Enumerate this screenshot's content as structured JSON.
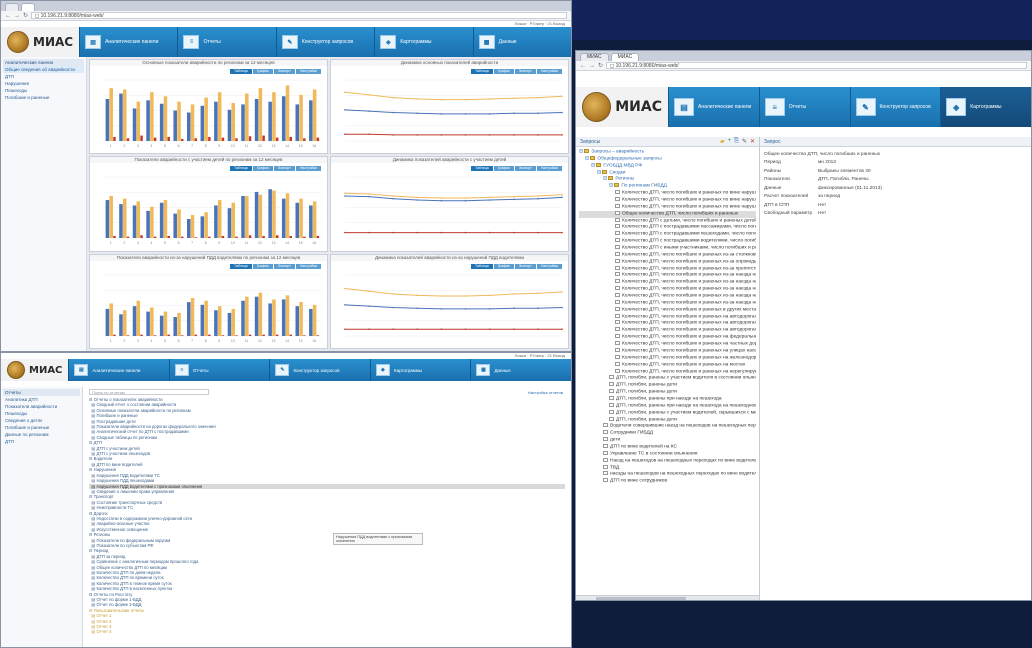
{
  "colors": {
    "accent_blue": "#1f74b6",
    "tile_blue": "#1a6fae",
    "bar_blue": "#4a73b8",
    "bar_orange": "#f0b95a",
    "bar_red": "#c0392b",
    "line_grey": "#bbbbbb"
  },
  "brand": "МИАС",
  "winA": {
    "tabs": [
      "",
      "",
      "x"
    ],
    "address": "◻ 10.196.21.9:8080/mias-web/",
    "topline": "Ложки · Р.Гомер · 21 Выход",
    "nav": [
      {
        "icon": "chart-icon",
        "label": "Аналитические панели"
      },
      {
        "icon": "report-icon",
        "label": "Отчеты"
      },
      {
        "icon": "constructor-icon",
        "label": "Конструктор запросов"
      },
      {
        "icon": "cartogram-icon",
        "label": "Картограммы"
      },
      {
        "icon": "data-icon",
        "label": "Данные"
      }
    ],
    "sidebar": {
      "head": "Аналитические панели",
      "items": [
        "Общие сведения об аварийности",
        "ДТП",
        "Нарушения",
        "Пешеходы",
        "Погибшие и раненые"
      ]
    },
    "panel_buttons": [
      "Таблица",
      "График",
      "Экспорт",
      "Настройки"
    ],
    "panels": [
      {
        "title": "Основные показатели аварийности по регионам за 12 месяцев"
      },
      {
        "title": "Динамика основных показателей аварийности"
      },
      {
        "title": "Показатели аварийности с участием детей по регионам за 12 месяцев"
      },
      {
        "title": "Динамика показателей аварийности с участием детей"
      },
      {
        "title": "Показатели аварийности из-за нарушений ПДД водителями по регионам за 12 месяцев"
      },
      {
        "title": "Динамика показателей аварийности из-за нарушений ПДД водителями"
      }
    ]
  },
  "winB": {
    "topline": "Ложки · Р.Гомер · 21 Выход",
    "nav": [
      {
        "icon": "chart-icon",
        "label": "Аналитические панели"
      },
      {
        "icon": "report-icon",
        "label": "Отчеты"
      },
      {
        "icon": "constructor-icon",
        "label": "Конструктор запросов"
      },
      {
        "icon": "cartogram-icon",
        "label": "Картограммы"
      },
      {
        "icon": "data-icon",
        "label": "Данные"
      }
    ],
    "sidebar": {
      "head": "Отчеты",
      "items": [
        "Аналитика ДТП",
        "Показатели аварийности",
        "Пешеходы",
        "Сведения о детях",
        "Погибшие и раненые",
        "Данные по регионам",
        "ДТП"
      ]
    },
    "search_placeholder": "Поиск по отчетам",
    "right_link": "Настройка отчетов",
    "tree": [
      "⊟ Отчеты о показателях аварийности",
      "  ▤ Сводный отчет о состоянии аварийности",
      "  ▤ Основные показатели аварийности по регионам",
      "  ▤ Погибшие и раненые",
      "  ▤ Пострадавшие дети",
      "  ▤ Показатели аварийности на дорогах федерального значения",
      "  ▤ Аналитический отчет по ДТП с пострадавшими",
      "  ▤ Сводные таблицы по регионам",
      "⊟ ДТП",
      "  ▤ ДТП с участием детей",
      "  ▤ ДТП с участием пешеходов",
      "⊟ Водители",
      "  ▤ ДТП по вине водителей",
      "⊟ Нарушения",
      "  ▤ Нарушения ПДД водителями ТС",
      "  ▤ Нарушения ПДД пешеходами",
      "  ▤ Нарушения ПДД водителями с признаками опьянения",
      "  ▤ Сведения о лишении права управления",
      "⊟ Транспорт",
      "  ▤ Состояние транспортных средств",
      "  ▤ Неисправности ТС",
      "⊟ Дороги",
      "  ▤ Недостатки в содержании улично-дорожной сети",
      "  ▤ Аварийно-опасные участки",
      "  ▤ Искусственное освещение",
      "⊟ Регионы",
      "  ▤ Показатели по федеральным округам",
      "  ▤ Показатели по субъектам РФ",
      "⊟ Период",
      "  ▤ ДТП за период",
      "  ▤ Сравнение с аналогичным периодом прошлого года",
      "  ▤ Общее количество ДТП по месяцам",
      "  ▤ Количество ДТП по дням недели",
      "  ▤ Количество ДТП по времени суток",
      "  ▤ Количество ДТП в темное время суток",
      "  ▤ Количество ДТП в населенных пунктах",
      "⊟ Отчеты по Росстату",
      "  ▤ Отчет по форме 1-БДД",
      "  ▤ Отчет по форме 2-БДД",
      "⊟ Пользовательские отчеты",
      "  ▤ Отчет 1",
      "  ▤ Отчет 2",
      "  ▤ Отчет 3",
      "  ▤ Отчет 4"
    ],
    "selected_index": 16,
    "tooltip": "Нарушения ПДД водителями с признаками опьянения"
  },
  "winC": {
    "tabs": [
      "МИАС",
      "МИАС",
      "x"
    ],
    "address": "◻ 10.196.21.9:8080/mias-web/",
    "nav": [
      {
        "icon": "chart-icon",
        "label": "Аналитические панели"
      },
      {
        "icon": "report-icon",
        "label": "Отчеты"
      },
      {
        "icon": "constructor-icon",
        "label": "Конструктор запросов"
      },
      {
        "icon": "cartogram-icon",
        "label": "Картограммы"
      }
    ],
    "left_head": "Запросы",
    "right_head": "Запрос",
    "tree": [
      {
        "t": "⊟",
        "i": "folder",
        "d": 0,
        "label": "Запросы – аварийность",
        "cls": "lnk"
      },
      {
        "t": "⊟",
        "i": "folder",
        "d": 1,
        "label": "Общефедеральные запросы",
        "cls": "lnk"
      },
      {
        "t": "⊟",
        "i": "folder",
        "d": 2,
        "label": "ГУОБДД МВД РФ",
        "cls": "lnk"
      },
      {
        "t": "⊟",
        "i": "folder",
        "d": 3,
        "label": "Сводки",
        "cls": "lnk"
      },
      {
        "t": "⊟",
        "i": "folder",
        "d": 4,
        "label": "Регионы",
        "cls": "lnk"
      },
      {
        "t": "⊟",
        "i": "folder",
        "d": 5,
        "label": "По регионам ГИБДД",
        "cls": "lnk"
      },
      {
        "t": "",
        "i": "doc",
        "d": 6,
        "label": "Количество ДТП, число погибших и раненых по вине нарушителей"
      },
      {
        "t": "",
        "i": "doc",
        "d": 6,
        "label": "Количество ДТП, число погибших и раненых по вине нарушителей"
      },
      {
        "t": "",
        "i": "doc",
        "d": 6,
        "label": "Количество ДТП, число погибших и раненых по вине нарушителей"
      },
      {
        "t": "",
        "i": "doc",
        "d": 6,
        "label": "Общее количество ДТП, число погибших и раненых",
        "cls": "sel"
      },
      {
        "t": "",
        "i": "doc",
        "d": 6,
        "label": "Количество ДТП с детьми, число погибших и раненых детей"
      },
      {
        "t": "",
        "i": "doc",
        "d": 6,
        "label": "Количество ДТП с пострадавшими пассажирами, число погибших"
      },
      {
        "t": "",
        "i": "doc",
        "d": 6,
        "label": "Количество ДТП с пострадавшими пешеходами, число погибших"
      },
      {
        "t": "",
        "i": "doc",
        "d": 6,
        "label": "Количество ДТП с пострадавшими водителями, число погибших"
      },
      {
        "t": "",
        "i": "doc",
        "d": 6,
        "label": "Количество ДТП с иными участниками, число погибших и раненых"
      },
      {
        "t": "",
        "i": "doc",
        "d": 6,
        "label": "Количество ДТП, число погибших и раненых из-за столкновения"
      },
      {
        "t": "",
        "i": "doc",
        "d": 6,
        "label": "Количество ДТП, число погибших и раненых из-за опрокидывания"
      },
      {
        "t": "",
        "i": "doc",
        "d": 6,
        "label": "Количество ДТП, число погибших и раненых из-за препятствия"
      },
      {
        "t": "",
        "i": "doc",
        "d": 6,
        "label": "Количество ДТП, число погибших и раненых из-за наезда на пешехода"
      },
      {
        "t": "",
        "i": "doc",
        "d": 6,
        "label": "Количество ДТП, число погибших и раненых из-за наезда на стоящее ТС"
      },
      {
        "t": "",
        "i": "doc",
        "d": 6,
        "label": "Количество ДТП, число погибших и раненых из-за наезда на велосипедиста"
      },
      {
        "t": "",
        "i": "doc",
        "d": 6,
        "label": "Количество ДТП, число погибших и раненых из-за наезда на гужевой транспорт"
      },
      {
        "t": "",
        "i": "doc",
        "d": 6,
        "label": "Количество ДТП, число погибших и раненых из-за наезда на животное"
      },
      {
        "t": "",
        "i": "doc",
        "d": 6,
        "label": "Количество ДТП, число погибших и раненых в других местах"
      },
      {
        "t": "",
        "i": "doc",
        "d": 6,
        "label": "Количество ДТП, число погибших и раненых на автодорогах"
      },
      {
        "t": "",
        "i": "doc",
        "d": 6,
        "label": "Количество ДТП, число погибших и раненых на автодорогах федерального значения"
      },
      {
        "t": "",
        "i": "doc",
        "d": 6,
        "label": "Количество ДТП, число погибших и раненых на автодорогах регионального значения"
      },
      {
        "t": "",
        "i": "doc",
        "d": 6,
        "label": "Количество ДТП, число погибших и раненых на федеральных трассах"
      },
      {
        "t": "",
        "i": "doc",
        "d": 6,
        "label": "Количество ДТП, число погибших и раненых на частных дорогах"
      },
      {
        "t": "",
        "i": "doc",
        "d": 6,
        "label": "Количество ДТП, число погибших и раненых на улицах населенных пунктов"
      },
      {
        "t": "",
        "i": "doc",
        "d": 6,
        "label": "Количество ДТП, число погибших и раненых на железнодорожных переездах"
      },
      {
        "t": "",
        "i": "doc",
        "d": 6,
        "label": "Количество ДТП, число погибших и раненых на мостах"
      },
      {
        "t": "",
        "i": "doc",
        "d": 6,
        "label": "Количество ДТП, число погибших и раненых на нерегулируемых перекрестках"
      },
      {
        "t": "",
        "i": "doc",
        "d": 5,
        "label": "ДТП, погибли, ранены с участием водителя в состоянии опьянения"
      },
      {
        "t": "",
        "i": "doc",
        "d": 5,
        "label": "ДТП, погибли, ранены дети"
      },
      {
        "t": "",
        "i": "doc",
        "d": 5,
        "label": "ДТП, погибли, ранены дети"
      },
      {
        "t": "",
        "i": "doc",
        "d": 5,
        "label": "ДТП, погибли, ранены при наезде на пешехода"
      },
      {
        "t": "",
        "i": "doc",
        "d": 5,
        "label": "ДТП, погибли, ранены при наезде на пешехода на пешеходном переходе"
      },
      {
        "t": "",
        "i": "doc",
        "d": 5,
        "label": "ДТП, погибли, ранены с участием водителей, скрывшихся с места ДТП"
      },
      {
        "t": "",
        "i": "doc",
        "d": 5,
        "label": "ДТП, погибли, ранены дети"
      },
      {
        "t": "",
        "i": "doc",
        "d": 4,
        "label": "Водители совершившие наезд на пешеходов на пешеходных переходах"
      },
      {
        "t": "",
        "i": "doc",
        "d": 4,
        "label": "Сотрудники ГИБДД"
      },
      {
        "t": "",
        "i": "doc",
        "d": 4,
        "label": "дети"
      },
      {
        "t": "",
        "i": "doc",
        "d": 4,
        "label": "ДТП по вине водителей на КС"
      },
      {
        "t": "",
        "i": "doc",
        "d": 4,
        "label": "Управление ТС в состоянии опьянения"
      },
      {
        "t": "",
        "i": "doc",
        "d": 4,
        "label": "Наезд на пешеходов на пешеходных переходах по вине водителей ТС"
      },
      {
        "t": "",
        "i": "doc",
        "d": 4,
        "label": "ТВД"
      },
      {
        "t": "",
        "i": "doc",
        "d": 4,
        "label": "наезды на пешеходов на пешеходных переходах по вине водителей"
      },
      {
        "t": "",
        "i": "doc",
        "d": 4,
        "label": "ДТП по вине сотрудников"
      }
    ],
    "props_title": "Общее количество ДТП, число погибших и раненых",
    "props": [
      {
        "k": "Период",
        "v": "мн 2013"
      },
      {
        "k": "Районы",
        "v": "Выбраны элементов 30"
      },
      {
        "k": "Показатели",
        "v": "ДТП, Погибли, Ранены"
      },
      {
        "k": "Данные",
        "v": "фиксированные (01.11.2013)"
      },
      {
        "k": "Расчет показателей",
        "v": "за период"
      },
      {
        "k": "ДТП в СПП",
        "v": "Нет"
      },
      {
        "k": "Свободный параметр",
        "v": "Нет"
      }
    ]
  },
  "chart_data": [
    {
      "type": "bar",
      "categories": [
        "1",
        "2",
        "3",
        "4",
        "5",
        "6",
        "7",
        "8",
        "9",
        "10",
        "11",
        "12",
        "13",
        "14",
        "15",
        "16"
      ],
      "series": [
        {
          "values": [
            62,
            70,
            48,
            60,
            55,
            45,
            42,
            52,
            58,
            46,
            54,
            62,
            58,
            66,
            54,
            60
          ]
        },
        {
          "values": [
            78,
            76,
            58,
            72,
            66,
            58,
            54,
            64,
            72,
            56,
            70,
            78,
            72,
            82,
            68,
            76
          ]
        },
        {
          "values": [
            6,
            4,
            8,
            5,
            6,
            3,
            4,
            6,
            5,
            4,
            7,
            8,
            5,
            6,
            4,
            5
          ]
        }
      ]
    },
    {
      "type": "line",
      "series": [
        {
          "values": [
            72,
            68,
            64,
            62,
            61,
            61,
            62,
            63,
            64,
            66
          ]
        },
        {
          "values": [
            46,
            44,
            42,
            41,
            40,
            40,
            40,
            41,
            41,
            42
          ]
        },
        {
          "values": [
            10,
            10,
            9,
            9,
            9,
            9,
            9,
            9,
            9,
            9
          ]
        }
      ]
    },
    {
      "type": "bar",
      "categories": [
        "1",
        "2",
        "3",
        "4",
        "5",
        "6",
        "7",
        "8",
        "9",
        "10",
        "11",
        "12",
        "13",
        "14",
        "15",
        "16"
      ],
      "series": [
        {
          "values": [
            56,
            50,
            48,
            40,
            52,
            36,
            28,
            32,
            48,
            44,
            62,
            68,
            72,
            58,
            52,
            48
          ]
        },
        {
          "values": [
            62,
            58,
            54,
            46,
            56,
            42,
            34,
            38,
            56,
            52,
            62,
            64,
            70,
            66,
            58,
            54
          ]
        },
        {
          "values": [
            3,
            2,
            4,
            2,
            3,
            2,
            1,
            2,
            3,
            2,
            4,
            3,
            4,
            3,
            2,
            3
          ]
        }
      ]
    },
    {
      "type": "line",
      "series": [
        {
          "values": [
            66,
            65,
            62,
            60,
            59,
            59,
            60,
            61,
            62,
            64
          ]
        },
        {
          "values": [
            62,
            61,
            58,
            56,
            55,
            55,
            56,
            57,
            58,
            60
          ]
        },
        {
          "values": [
            8,
            8,
            8,
            8,
            8,
            8,
            8,
            8,
            8,
            8
          ]
        }
      ]
    },
    {
      "type": "bar",
      "categories": [
        "1",
        "2",
        "3",
        "4",
        "5",
        "6",
        "7",
        "8",
        "9",
        "10",
        "11",
        "12",
        "13",
        "14",
        "15",
        "16"
      ],
      "series": [
        {
          "values": [
            40,
            32,
            44,
            36,
            30,
            28,
            50,
            46,
            38,
            34,
            52,
            58,
            48,
            54,
            44,
            40
          ]
        },
        {
          "values": [
            48,
            38,
            52,
            42,
            36,
            34,
            56,
            52,
            44,
            40,
            58,
            64,
            54,
            60,
            50,
            46
          ]
        },
        {
          "values": [
            2,
            1,
            2,
            1,
            2,
            1,
            2,
            2,
            1,
            1,
            2,
            2,
            2,
            2,
            1,
            1
          ]
        }
      ]
    },
    {
      "type": "line",
      "series": [
        {
          "values": [
            70,
            66,
            62,
            60,
            59,
            59,
            60,
            62,
            63,
            65
          ]
        },
        {
          "values": [
            46,
            44,
            42,
            41,
            40,
            40,
            40,
            41,
            41,
            42
          ]
        },
        {
          "values": [
            10,
            10,
            10,
            10,
            10,
            10,
            10,
            10,
            10,
            10
          ]
        }
      ]
    }
  ]
}
